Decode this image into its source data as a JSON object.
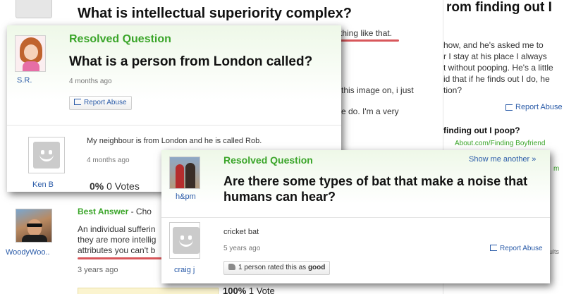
{
  "bg_page": {
    "title": "What is intellectual superiority complex?",
    "snippet_a": "thing like that.",
    "snippet_b": "this image on, i just",
    "snippet_c": "e do. I'm a very",
    "best_answer_label": "Best Answer",
    "best_answer_rest": "- Cho",
    "answer_lines": [
      "An individual sufferin",
      "they are more intellig",
      "attributes you can't b"
    ],
    "user_name": "WoodyWoo..",
    "time": "3 years ago",
    "vote_percent": "100%",
    "vote_text": "1 Vote"
  },
  "right_page": {
    "title": "rom finding out I",
    "lines": [
      "how, and he's asked me to",
      "r I stay at his place I always",
      "t without pooping. He's a little",
      "id that if he finds out I do, he",
      "tion?"
    ],
    "report_label": "Report Abuse",
    "ad_title": "finding out I poop?",
    "ad_link": "About.com/Finding Boyfriend",
    "cut_a": "m",
    "cut_b": "ults"
  },
  "london": {
    "resolved_label": "Resolved Question",
    "question": "What is a person from London called?",
    "asker_name": "S.R.",
    "time": "4 months ago",
    "report_label": "Report Abuse",
    "answer_text": "My neighbour is from London and he is called Rob.",
    "answer_time": "4 months ago",
    "answerer_name": "Ken B",
    "votes_percent": "0%",
    "votes_text": "0 Votes"
  },
  "bat": {
    "resolved_label": "Resolved Question",
    "show_more": "Show me another »",
    "question": "Are there some types of bat that make a noise that humans can hear?",
    "asker_name": "h&pm",
    "answer_text": "cricket bat",
    "answer_time": "5 years ago",
    "report_label": "Report Abuse",
    "answerer_name": "craig j",
    "rated_prefix": "1 person rated this as",
    "rated_word": "good"
  }
}
